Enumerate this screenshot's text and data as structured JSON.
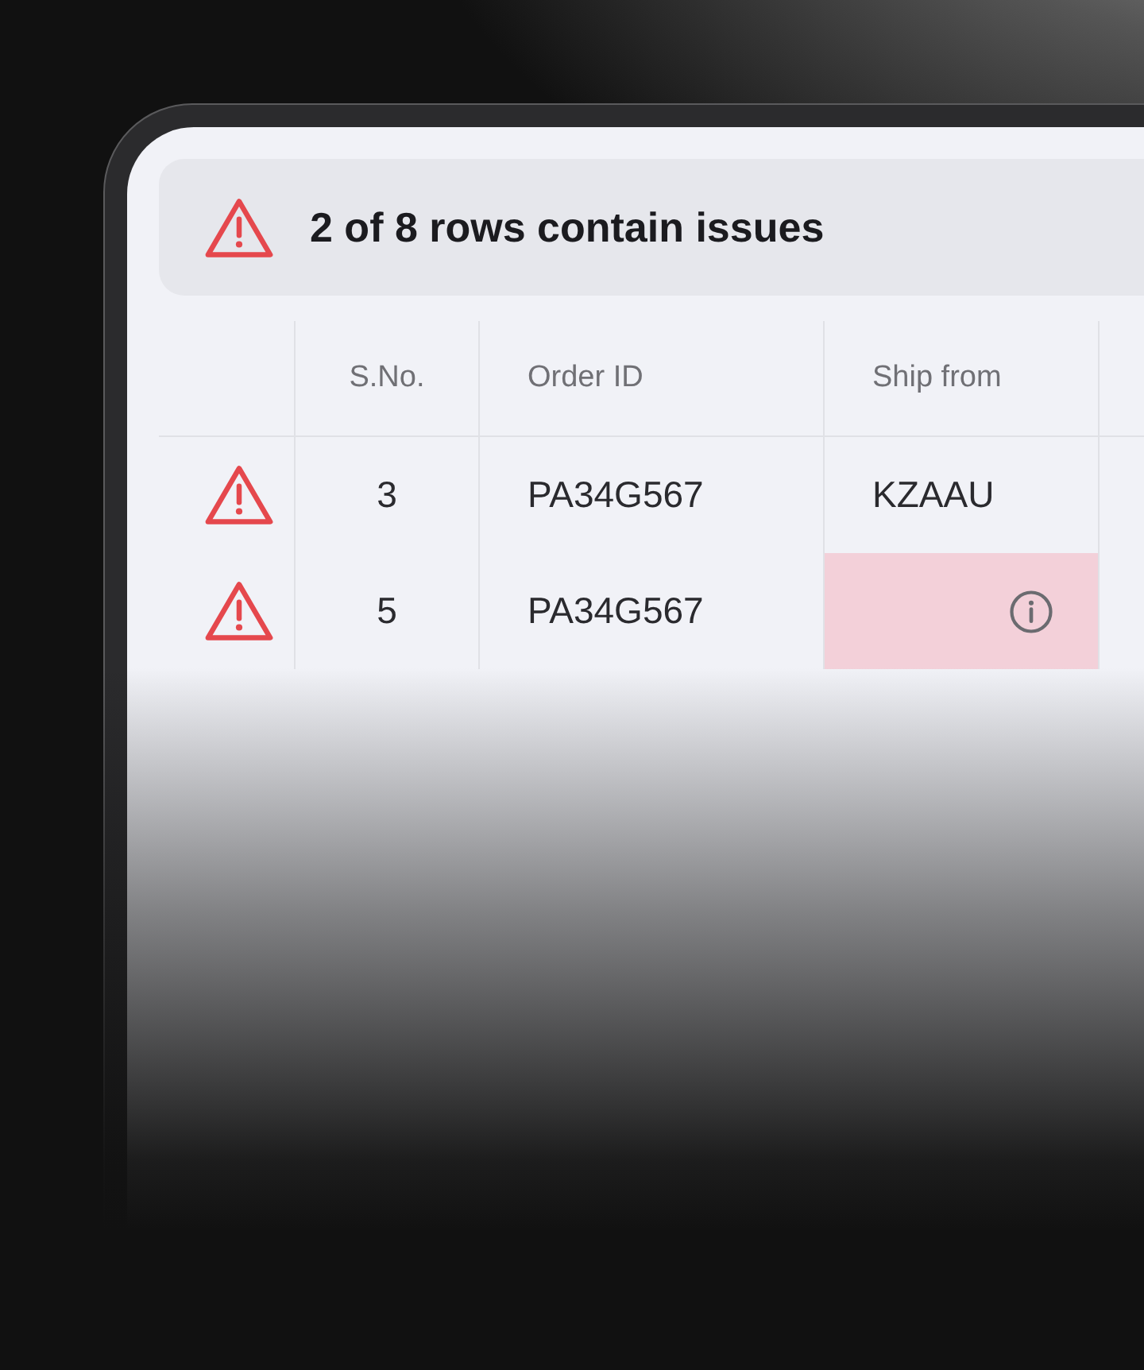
{
  "banner": {
    "message": "2 of 8 rows contain issues"
  },
  "table": {
    "columns": [
      "S.No.",
      "Order ID",
      "Ship from"
    ],
    "rows": [
      {
        "warning": true,
        "sno": "3",
        "order_id": "PA34G567",
        "ship_from": "KZAAU",
        "ship_from_invalid": false
      },
      {
        "warning": true,
        "sno": "5",
        "order_id": "PA34G567",
        "ship_from_invalid": true
      }
    ]
  }
}
